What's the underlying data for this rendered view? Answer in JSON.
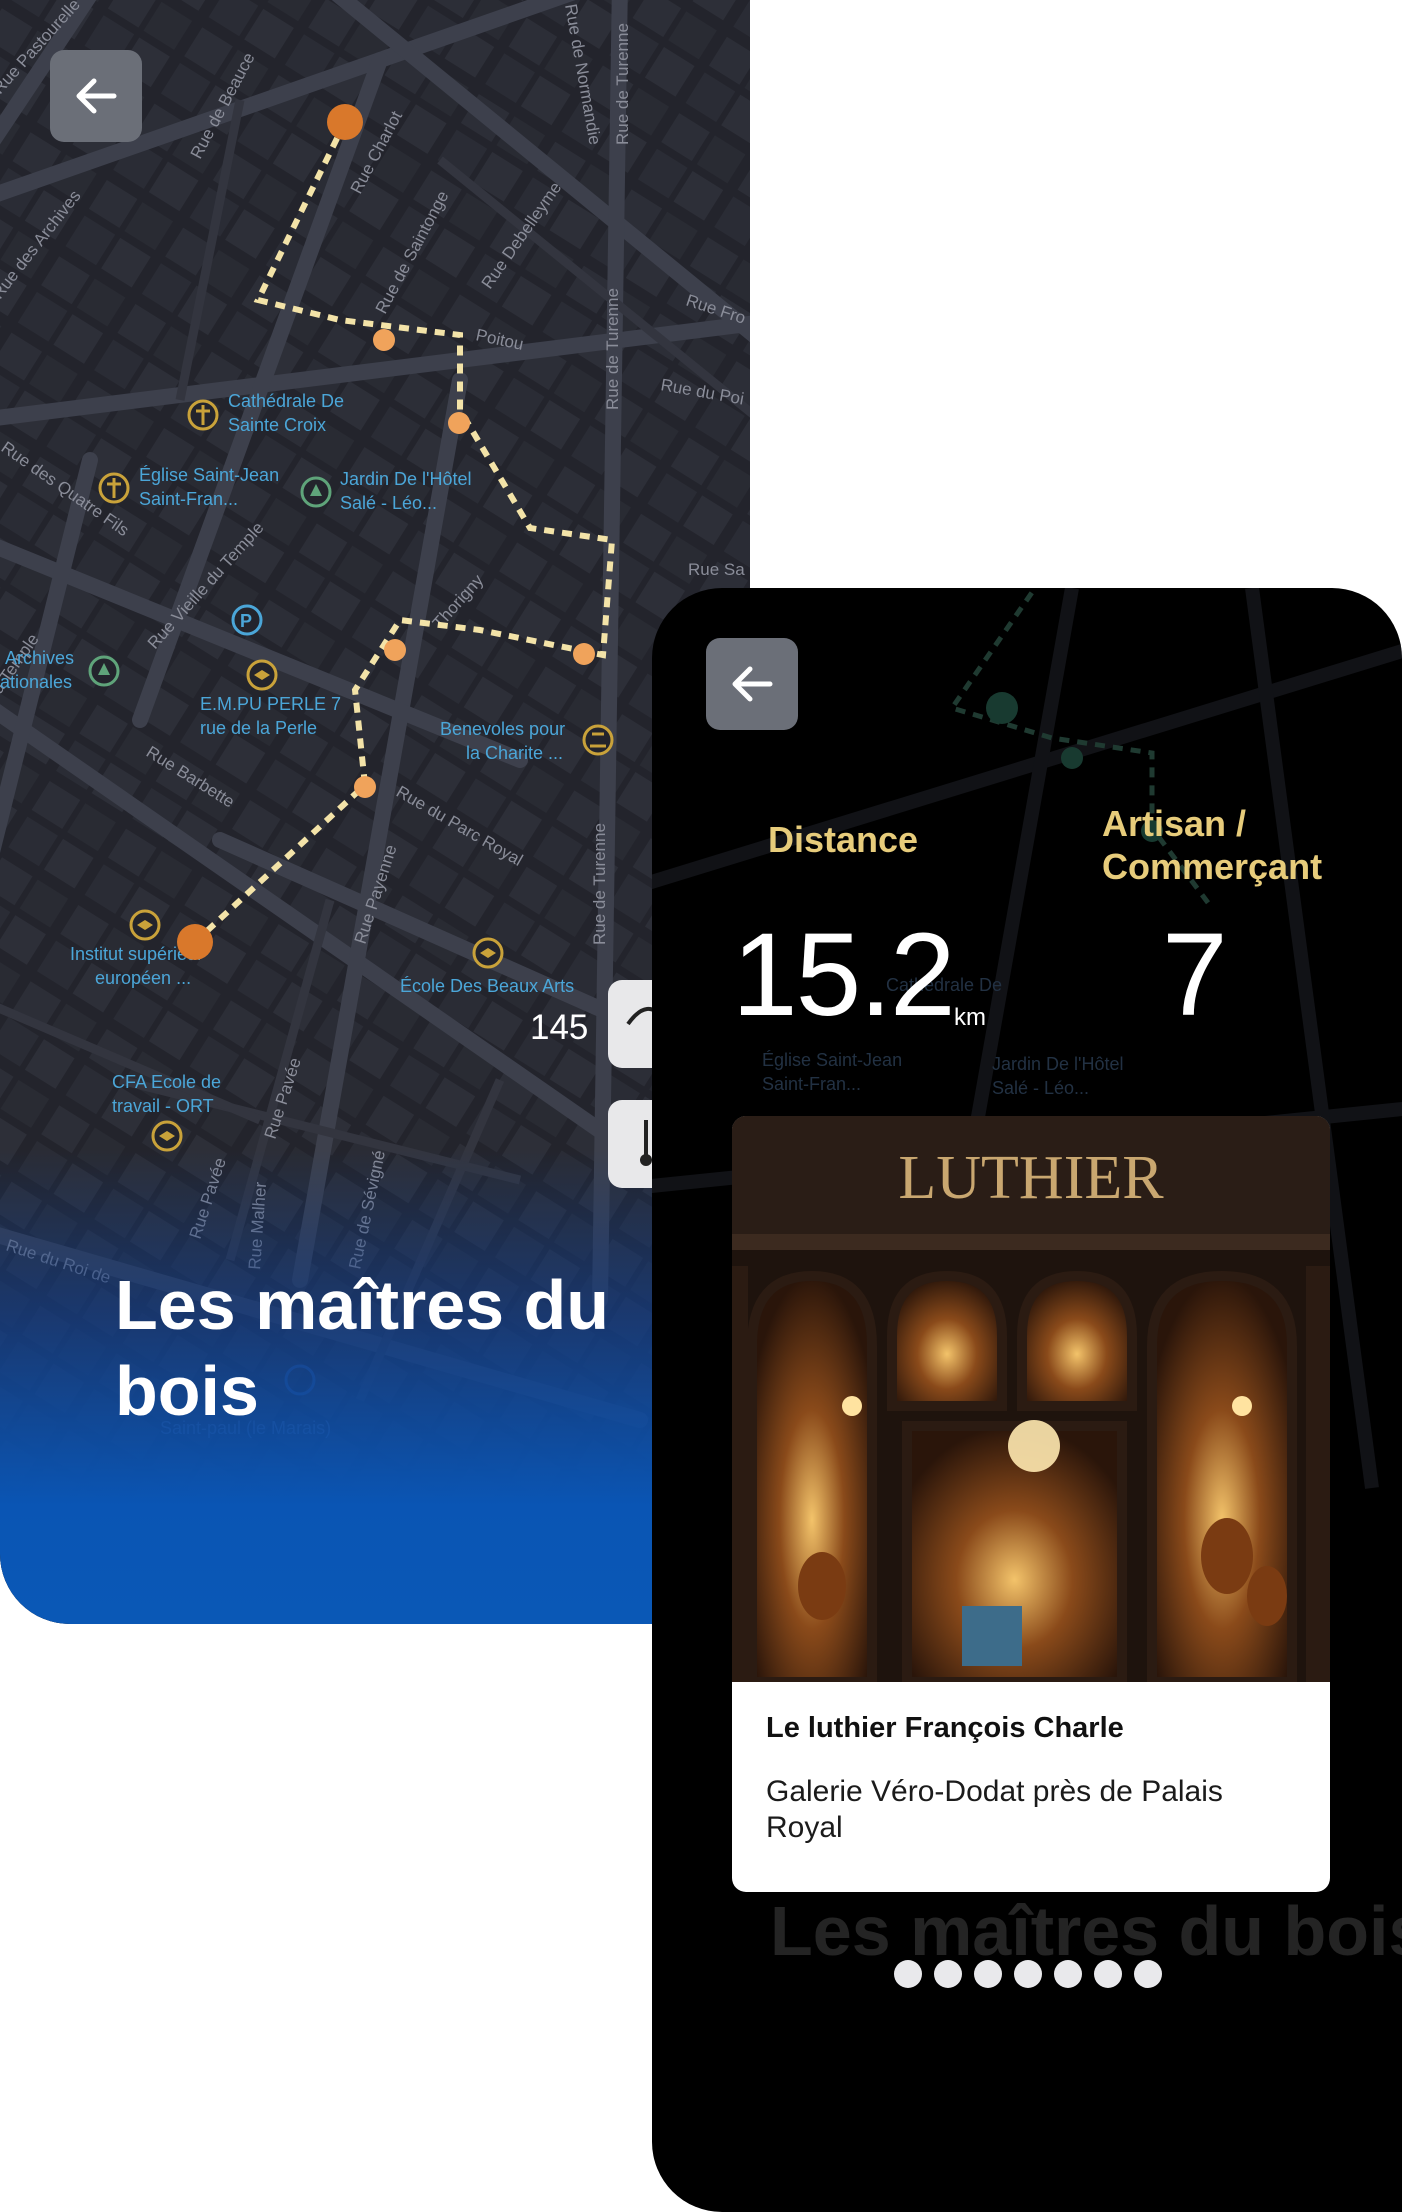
{
  "map_screen": {
    "title": "Les maîtres du bois",
    "counter": "145",
    "streets": [
      "Rue de Beauce",
      "Rue Charlot",
      "Rue de Saintonge",
      "Rue Debelleyme",
      "Rue de Turenne",
      "Rue de Normandie",
      "Rue de Poitou",
      "Rue du Poitou",
      "Rue Froissart",
      "Rue Vieille du Temple",
      "Rue des Quatre Fils",
      "Rue Barbette",
      "Rue du Parc Royal",
      "Rue Payenne",
      "Rue Pavée",
      "Rue Malher",
      "Rue de Sévigné",
      "Rue du Roi de Sicile",
      "Rue des Archives",
      "Rue Pastourelle",
      "Rue de Thorigny",
      "Rue Saint"
    ],
    "pois": [
      {
        "label_line1": "Cathédrale De",
        "label_line2": "Sainte Croix",
        "icon": "church-icon"
      },
      {
        "label_line1": "Église Saint-Jean",
        "label_line2": "Saint-Fran...",
        "icon": "church-icon"
      },
      {
        "label_line1": "Jardin De l'Hôtel",
        "label_line2": "Salé - Léo...",
        "icon": "park-icon"
      },
      {
        "label_line1": "E.M.PU PERLE 7",
        "label_line2": "rue de la Perle",
        "icon": "school-icon"
      },
      {
        "label_line1": "Benevoles pour",
        "label_line2": "la Charite ...",
        "icon": "museum-icon"
      },
      {
        "label_line1": "Archives",
        "label_line2": "ationales",
        "icon": "park-icon"
      },
      {
        "label_line1": "Institut supérieur",
        "label_line2": "européen ...",
        "icon": "school-icon"
      },
      {
        "label_line1": "École Des Beaux Arts",
        "label_line2": "",
        "icon": "school-icon"
      },
      {
        "label_line1": "CFA Ecole de",
        "label_line2": "travail - ORT",
        "icon": "school-icon"
      },
      {
        "label_line1": "Saint-paul (le Marais)",
        "label_line2": "",
        "icon": "metro-icon"
      }
    ]
  },
  "detail_screen": {
    "distance_label": "Distance",
    "distance_value": "15.2",
    "distance_unit": "km",
    "artisan_label_line1": "Artisan /",
    "artisan_label_line2": "Commerçant",
    "artisan_value": "7",
    "place": {
      "shop_sign": "LUTHIER",
      "name": "Le luthier François Charle",
      "description": "Galerie Véro-Dodat près de Palais Royal"
    },
    "ghost_title": "Les maîtres du bois",
    "page_dots": 7
  },
  "colors": {
    "accent_gold": "#e7cc7b",
    "route_dot": "#f0a35b",
    "route_start": "#d9782b",
    "map_bg": "#23242c",
    "gradient_blue": "#0a58b6"
  }
}
